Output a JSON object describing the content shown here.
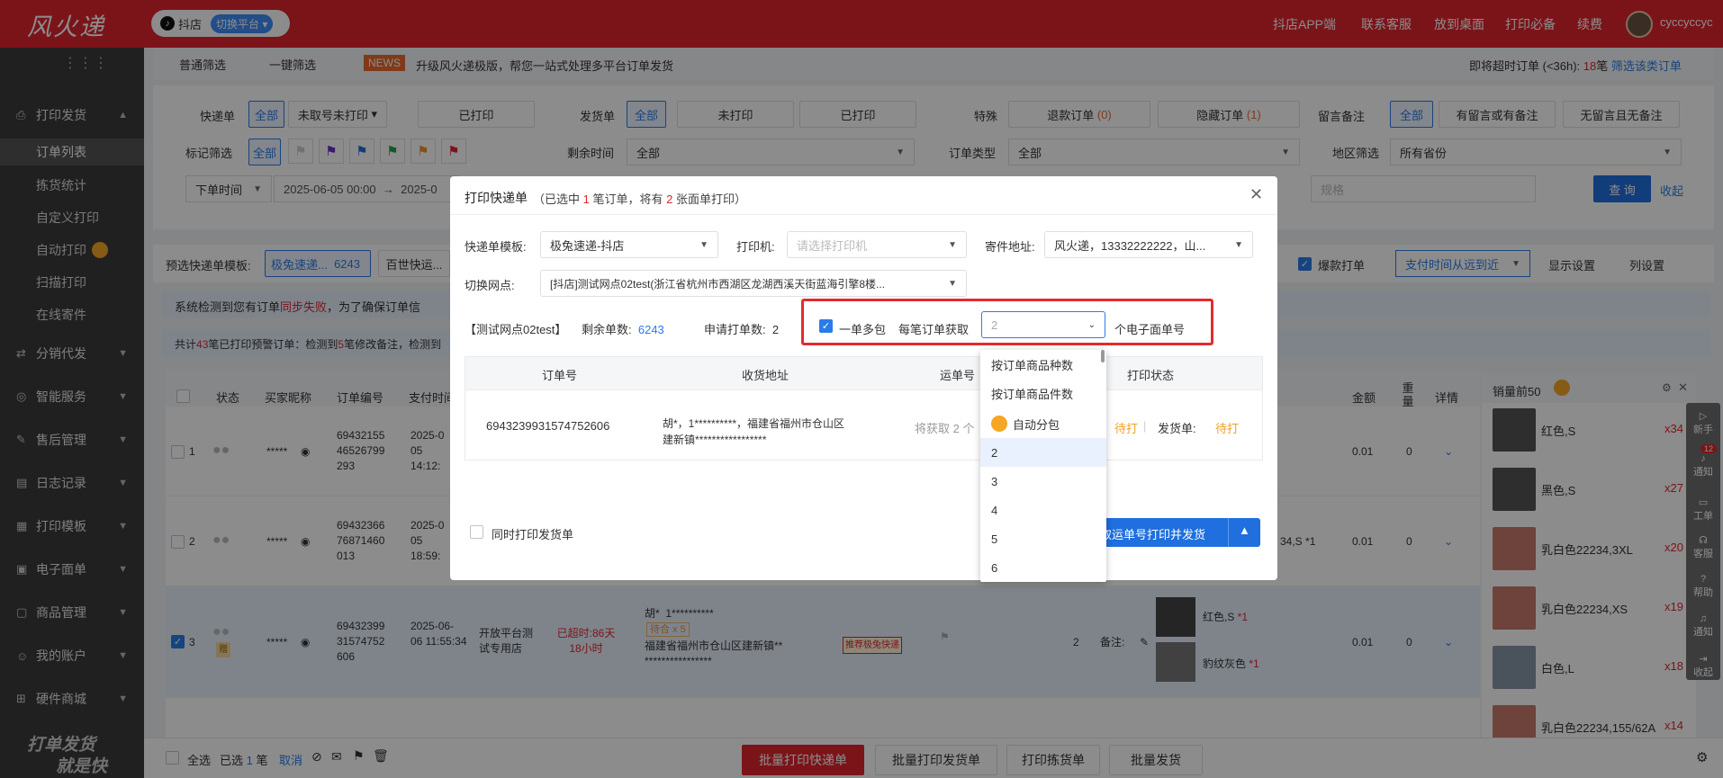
{
  "header": {
    "logo": "风火递",
    "platform": "抖店",
    "switch_platform": "切换平台",
    "links": [
      "抖店APP端",
      "联系客服",
      "放到桌面",
      "打印必备",
      "续费"
    ],
    "username": "cyccyccyc"
  },
  "sidebar": {
    "sections": [
      {
        "label": "打印发货",
        "icon": "print-icon",
        "items": [
          "订单列表",
          "拣货统计",
          "自定义打印",
          "自动打印",
          "扫描打印",
          "在线寄件"
        ]
      },
      {
        "label": "分销代发",
        "icon": "share-icon"
      },
      {
        "label": "智能服务",
        "icon": "smart-icon"
      },
      {
        "label": "售后管理",
        "icon": "wrench-icon"
      },
      {
        "label": "日志记录",
        "icon": "log-icon"
      },
      {
        "label": "打印模板",
        "icon": "template-icon"
      },
      {
        "label": "电子面单",
        "icon": "waybill-icon"
      },
      {
        "label": "商品管理",
        "icon": "goods-icon"
      },
      {
        "label": "我的账户",
        "icon": "user-icon"
      },
      {
        "label": "硬件商城",
        "icon": "store-icon"
      }
    ],
    "slogan_line1": "打单发货",
    "slogan_line2": "就是快"
  },
  "filter_tabs": [
    "普通筛选",
    "一键筛选"
  ],
  "news": {
    "badge": "NEWS",
    "text": "升级风火递极版，帮您一站式处理多平台订单发货"
  },
  "overdue": {
    "text": "即将超时订单 (<36h): ",
    "count": "18",
    "unit": "笔",
    "link": "筛选该类订单"
  },
  "filters": {
    "waybill_label": "快递单",
    "all": "全部",
    "unprinted": "未取号未打印",
    "printed": "已打印",
    "shipping_label": "发货单",
    "ship_unprinted": "未打印",
    "ship_printed": "已打印",
    "special_label": "特殊",
    "refund": "退款订单",
    "refund_count": "(0)",
    "hidden": "隐藏订单",
    "hidden_count": "(1)",
    "remark_label": "留言备注",
    "remark_any": "有留言或有备注",
    "remark_none": "无留言且无备注",
    "mark_label": "标记筛选",
    "remain_label": "剩余时间",
    "remain_value": "全部",
    "order_type_label": "订单类型",
    "order_type_value": "全部",
    "region_label": "地区筛选",
    "region_value": "所有省份",
    "time_type": "下单时间",
    "time_start": "2025-06-05 00:00",
    "time_arrow": "→",
    "time_end": "2025-0",
    "spec_placeholder": "规格",
    "query": "查 询",
    "collapse": "收起"
  },
  "preselect": {
    "label": "预选快递单模板:",
    "tpl1": "极兔速递...",
    "tpl1_count": "6243",
    "tpl2": "百世快运...",
    "hot_label": "爆款打单",
    "sort": "支付时间从远到近",
    "display_settings": "显示设置",
    "column_settings": "列设置"
  },
  "alerts": {
    "sync_fail_prefix": "系统检测到您有订单",
    "sync_fail_red": "同步失败",
    "sync_fail_suffix": "，为了确保订单信",
    "warn_prefix": "共计",
    "warn_count1": "43",
    "warn_mid": "笔已打印预警订单：检测到",
    "warn_count2": "5",
    "warn_suffix": "笔修改备注，检测到"
  },
  "table": {
    "headers": [
      "状态",
      "买家昵称",
      "订单编号",
      "支付时间",
      "金额",
      "重量",
      "详情"
    ],
    "rows": [
      {
        "idx": "1",
        "buyer": "*****",
        "order_no": "69432155 46526799 293",
        "pay_time": "2025-0 05 14:12:",
        "amount": "0.01",
        "weight": "0"
      },
      {
        "idx": "2",
        "buyer": "*****",
        "order_no": "69432366 76871460 013",
        "pay_time": "2025-0 05 18:59:",
        "amount": "0.01",
        "weight": "0",
        "extra": "34,S *1"
      },
      {
        "idx": "3",
        "buyer": "*****",
        "order_no": "69432399 31574752 606",
        "pay_time": "2025-06- 06 11:55:34",
        "shop": "开放平台测 试专用店",
        "overdue": "已超时:86天 18小时",
        "addr_name": "胡*",
        "addr_phone": "1**********",
        "tag1": "待合 x 5",
        "addr": "福建省福州市仓山区建新镇** ****************",
        "express_tag": "推荐极兔快递",
        "qty": "2",
        "note_label": "备注:",
        "goods": [
          {
            "name": "红色,S",
            "count": "*1"
          },
          {
            "name": "豹纹灰色",
            "count": "*1"
          }
        ],
        "amount": "0.01",
        "weight": "0",
        "gift": "赠"
      }
    ]
  },
  "top_sellers": {
    "title": "销量前50",
    "items": [
      {
        "name": "红色,S",
        "count": "x34"
      },
      {
        "name": "黑色,S",
        "count": "x27"
      },
      {
        "name": "乳白色22234,3XL",
        "count": "x20"
      },
      {
        "name": "乳白色22234,XS",
        "count": "x19"
      },
      {
        "name": "白色,L",
        "count": "x18"
      },
      {
        "name": "乳白色22234,155/62A",
        "count": "x14"
      }
    ]
  },
  "right_rail": [
    "新手",
    "通知",
    "工单",
    "客服",
    "帮助",
    "通知",
    "收起"
  ],
  "right_rail_badge": "12",
  "bottom": {
    "select_all": "全选",
    "selected_prefix": "已选",
    "selected_count": "1",
    "selected_unit": "笔",
    "cancel": "取消",
    "batch_print_waybill": "批量打印快递单",
    "batch_print_shipping": "批量打印发货单",
    "print_picking": "打印拣货单",
    "batch_ship": "批量发货"
  },
  "dialog": {
    "title": "打印快递单",
    "subtitle_1": "（已选中 ",
    "sel_count": "1",
    "subtitle_2": " 笔订单，将有 ",
    "sheet_count": "2",
    "subtitle_3": " 张面单打印）",
    "tpl_label": "快递单模板:",
    "tpl_value": "极兔速递-抖店",
    "printer_label": "打印机:",
    "printer_placeholder": "请选择打印机",
    "sender_label": "寄件地址:",
    "sender_value": "风火递，13332222222，山...",
    "branch_label": "切换网点:",
    "branch_value": "[抖店]测试网点02test(浙江省杭州市西湖区龙湖西溪天街蓝海引擎8楼...",
    "branch_name": "【测试网点02test】",
    "remain_label": "剩余单数:",
    "remain_value": "6243",
    "apply_label": "申请打单数:",
    "apply_value": "2",
    "multi_pkg": "一单多包",
    "per_order": "每笔订单获取",
    "per_order_value": "2",
    "unit_text": "个电子面单号",
    "table_headers": [
      "订单号",
      "收货地址",
      "运单号",
      "打印状态"
    ],
    "row": {
      "order_no": "6943239931574752606",
      "addr": "胡*，1**********，福建省福州市仓山区建新镇*****************",
      "waybill": "将获取 2 个",
      "status_pending": "待打",
      "ship_label": "发货单:",
      "ship_pending": "待打"
    },
    "also_print_shipping": "同时打印发货单",
    "confirm": "取运单号打印并发货"
  },
  "dropdown": {
    "options": [
      "按订单商品种数",
      "按订单商品件数",
      "自动分包",
      "2",
      "3",
      "4",
      "5",
      "6"
    ],
    "selected": "2"
  },
  "colors": {
    "brand_red": "#e0262e",
    "primary_blue": "#1f6fde",
    "highlight_red": "#e52b2b"
  }
}
